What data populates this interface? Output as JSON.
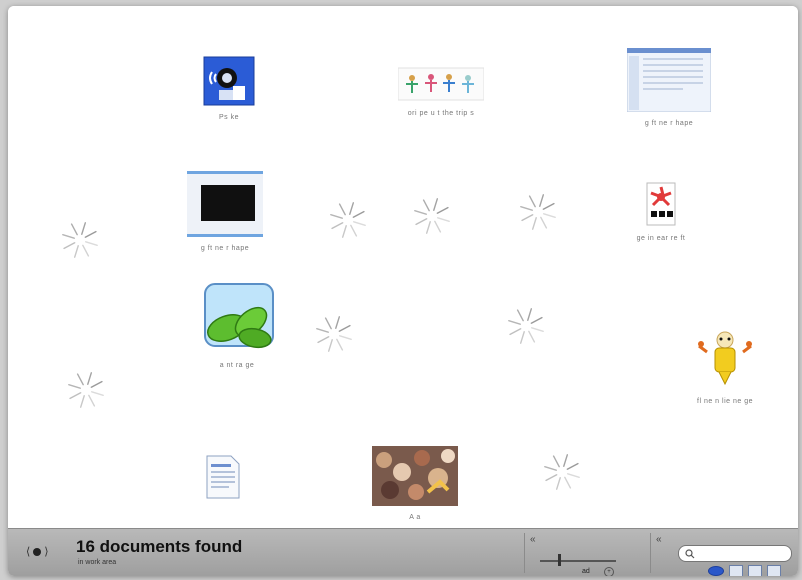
{
  "documents": [
    {
      "label": "Ps  ke",
      "icon": "blue-app-icon"
    },
    {
      "label": "ori   pe  u t   the  trip  s",
      "icon": "figures-strip-icon"
    },
    {
      "label": "g  ft  ne  r  hape",
      "icon": "window-screenshot-icon"
    },
    {
      "label": "g  ft  ne  r  hape",
      "icon": "dark-screen-icon"
    },
    {
      "label": "     ge   in    ear  re  ft",
      "icon": "flower-sticker-icon"
    },
    {
      "label": "a  nt  ra  ge",
      "icon": "green-leaves-icon"
    },
    {
      "label": "fl  ne  n  lie  ne  ge",
      "icon": "cartoon-character-icon"
    },
    {
      "label": "",
      "icon": "text-document-icon"
    },
    {
      "label": "A          a",
      "icon": "photo-thumbnail-icon"
    }
  ],
  "status": {
    "title": "16 documents found",
    "subtitle": "in work area"
  },
  "search": {
    "placeholder": ""
  },
  "zoom": {
    "label": "ad",
    "button": "+"
  },
  "colors": {
    "accent": "#2b57c9",
    "status_bar": "#aaaaaa"
  }
}
